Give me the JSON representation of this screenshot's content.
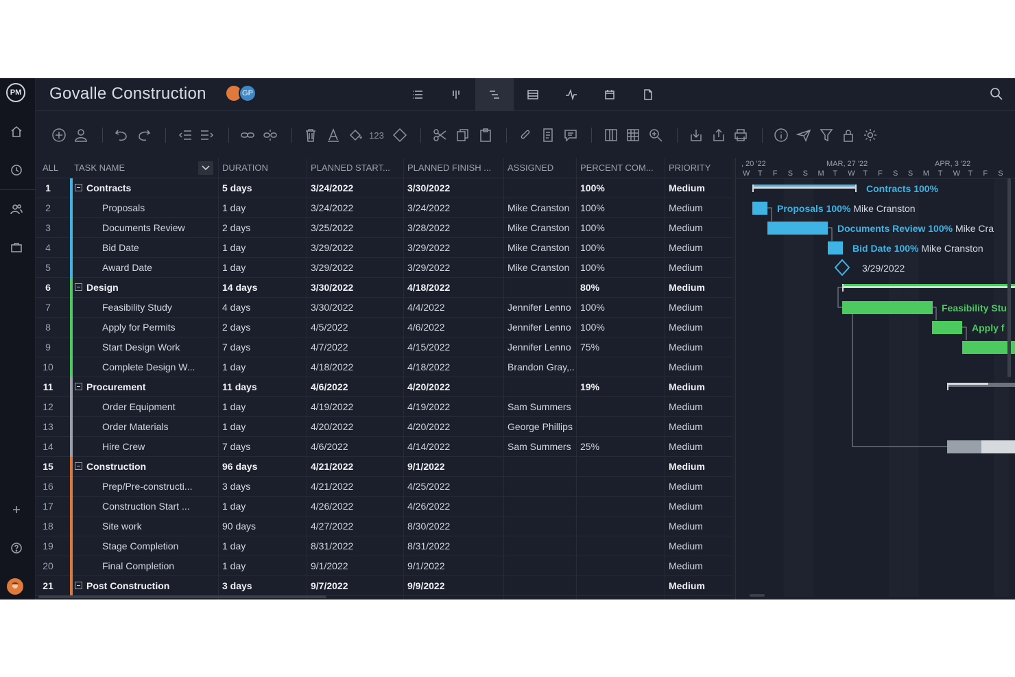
{
  "header": {
    "title": "Govalle Construction",
    "avatar_initials": "GP",
    "view_tabs": [
      "list-icon",
      "board-icon",
      "gantt-icon",
      "sheet-icon",
      "dashboard-icon",
      "calendar-icon",
      "document-icon"
    ],
    "active_view": "gantt-icon"
  },
  "toolbar": {
    "number_format_label": "123"
  },
  "grid": {
    "columns": [
      "ALL",
      "TASK NAME",
      "DURATION",
      "PLANNED START...",
      "PLANNED FINISH ...",
      "ASSIGNED",
      "PERCENT COM...",
      "PRIORITY"
    ],
    "rows": [
      {
        "id": "1",
        "name": "Contracts",
        "duration": "5 days",
        "start": "3/24/2022",
        "finish": "3/30/2022",
        "assigned": "",
        "percent": "100%",
        "priority": "Medium",
        "group": true,
        "color": "#3fb3e4"
      },
      {
        "id": "2",
        "name": "Proposals",
        "duration": "1 day",
        "start": "3/24/2022",
        "finish": "3/24/2022",
        "assigned": "Mike Cranston",
        "percent": "100%",
        "priority": "Medium",
        "group": false,
        "color": "#3fb3e4"
      },
      {
        "id": "3",
        "name": "Documents Review",
        "duration": "2 days",
        "start": "3/25/2022",
        "finish": "3/28/2022",
        "assigned": "Mike Cranston",
        "percent": "100%",
        "priority": "Medium",
        "group": false,
        "color": "#3fb3e4"
      },
      {
        "id": "4",
        "name": "Bid Date",
        "duration": "1 day",
        "start": "3/29/2022",
        "finish": "3/29/2022",
        "assigned": "Mike Cranston",
        "percent": "100%",
        "priority": "Medium",
        "group": false,
        "color": "#3fb3e4"
      },
      {
        "id": "5",
        "name": "Award Date",
        "duration": "1 day",
        "start": "3/29/2022",
        "finish": "3/29/2022",
        "assigned": "Mike Cranston",
        "percent": "100%",
        "priority": "Medium",
        "group": false,
        "color": "#3fb3e4"
      },
      {
        "id": "6",
        "name": "Design",
        "duration": "14 days",
        "start": "3/30/2022",
        "finish": "4/18/2022",
        "assigned": "",
        "percent": "80%",
        "priority": "Medium",
        "group": true,
        "color": "#4cc95f"
      },
      {
        "id": "7",
        "name": "Feasibility Study",
        "duration": "4 days",
        "start": "3/30/2022",
        "finish": "4/4/2022",
        "assigned": "Jennifer Lenno",
        "percent": "100%",
        "priority": "Medium",
        "group": false,
        "color": "#4cc95f"
      },
      {
        "id": "8",
        "name": "Apply for Permits",
        "duration": "2 days",
        "start": "4/5/2022",
        "finish": "4/6/2022",
        "assigned": "Jennifer Lenno",
        "percent": "100%",
        "priority": "Medium",
        "group": false,
        "color": "#4cc95f"
      },
      {
        "id": "9",
        "name": "Start Design Work",
        "duration": "7 days",
        "start": "4/7/2022",
        "finish": "4/15/2022",
        "assigned": "Jennifer Lenno",
        "percent": "75%",
        "priority": "Medium",
        "group": false,
        "color": "#4cc95f"
      },
      {
        "id": "10",
        "name": "Complete Design W...",
        "duration": "1 day",
        "start": "4/18/2022",
        "finish": "4/18/2022",
        "assigned": "Brandon Gray,..",
        "percent": "",
        "priority": "Medium",
        "group": false,
        "color": "#4cc95f"
      },
      {
        "id": "11",
        "name": "Procurement",
        "duration": "11 days",
        "start": "4/6/2022",
        "finish": "4/20/2022",
        "assigned": "",
        "percent": "19%",
        "priority": "Medium",
        "group": true,
        "color": "#9aa0aa"
      },
      {
        "id": "12",
        "name": "Order Equipment",
        "duration": "1 day",
        "start": "4/19/2022",
        "finish": "4/19/2022",
        "assigned": "Sam Summers",
        "percent": "",
        "priority": "Medium",
        "group": false,
        "color": "#9aa0aa"
      },
      {
        "id": "13",
        "name": "Order Materials",
        "duration": "1 day",
        "start": "4/20/2022",
        "finish": "4/20/2022",
        "assigned": "George Phillips",
        "percent": "",
        "priority": "Medium",
        "group": false,
        "color": "#9aa0aa"
      },
      {
        "id": "14",
        "name": "Hire Crew",
        "duration": "7 days",
        "start": "4/6/2022",
        "finish": "4/14/2022",
        "assigned": "Sam Summers",
        "percent": "25%",
        "priority": "Medium",
        "group": false,
        "color": "#9aa0aa"
      },
      {
        "id": "15",
        "name": "Construction",
        "duration": "96 days",
        "start": "4/21/2022",
        "finish": "9/1/2022",
        "assigned": "",
        "percent": "",
        "priority": "Medium",
        "group": true,
        "color": "#e0773a"
      },
      {
        "id": "16",
        "name": "Prep/Pre-constructi...",
        "duration": "3 days",
        "start": "4/21/2022",
        "finish": "4/25/2022",
        "assigned": "",
        "percent": "",
        "priority": "Medium",
        "group": false,
        "color": "#e0773a"
      },
      {
        "id": "17",
        "name": "Construction Start ...",
        "duration": "1 day",
        "start": "4/26/2022",
        "finish": "4/26/2022",
        "assigned": "",
        "percent": "",
        "priority": "Medium",
        "group": false,
        "color": "#e0773a"
      },
      {
        "id": "18",
        "name": "Site work",
        "duration": "90 days",
        "start": "4/27/2022",
        "finish": "8/30/2022",
        "assigned": "",
        "percent": "",
        "priority": "Medium",
        "group": false,
        "color": "#e0773a"
      },
      {
        "id": "19",
        "name": "Stage Completion",
        "duration": "1 day",
        "start": "8/31/2022",
        "finish": "8/31/2022",
        "assigned": "",
        "percent": "",
        "priority": "Medium",
        "group": false,
        "color": "#e0773a"
      },
      {
        "id": "20",
        "name": "Final Completion",
        "duration": "1 day",
        "start": "9/1/2022",
        "finish": "9/1/2022",
        "assigned": "",
        "percent": "",
        "priority": "Medium",
        "group": false,
        "color": "#e0773a"
      },
      {
        "id": "21",
        "name": "Post Construction",
        "duration": "3 days",
        "start": "9/7/2022",
        "finish": "9/9/2022",
        "assigned": "",
        "percent": "",
        "priority": "Medium",
        "group": true,
        "color": "#e0773a"
      }
    ]
  },
  "gantt": {
    "week_labels": [
      ", 20 '22",
      "MAR, 27 '22",
      "APR, 3 '22"
    ],
    "day_letters": [
      "W",
      "T",
      "F",
      "S",
      "S",
      "M",
      "T",
      "W",
      "T",
      "F",
      "S",
      "S",
      "M",
      "T",
      "W",
      "T",
      "F",
      "S"
    ],
    "bar_labels": [
      {
        "name": "Contracts",
        "percent": "100%",
        "assignee": ""
      },
      {
        "name": "Proposals",
        "percent": "100%",
        "assignee": "Mike Cranston"
      },
      {
        "name": "Documents Review",
        "percent": "100%",
        "assignee": "Mike Cra"
      },
      {
        "name": "Bid Date",
        "percent": "100%",
        "assignee": "Mike Cranston"
      },
      {
        "name": "3/29/2022",
        "percent": "",
        "assignee": ""
      },
      {
        "name": "Feasibility Stu",
        "percent": "",
        "assignee": ""
      },
      {
        "name": "Apply f",
        "percent": "",
        "assignee": ""
      }
    ],
    "colors": {
      "blue": "#3fb3e4",
      "green": "#4cc95f",
      "gray": "#9aa0aa",
      "light": "#d6d9de"
    }
  }
}
